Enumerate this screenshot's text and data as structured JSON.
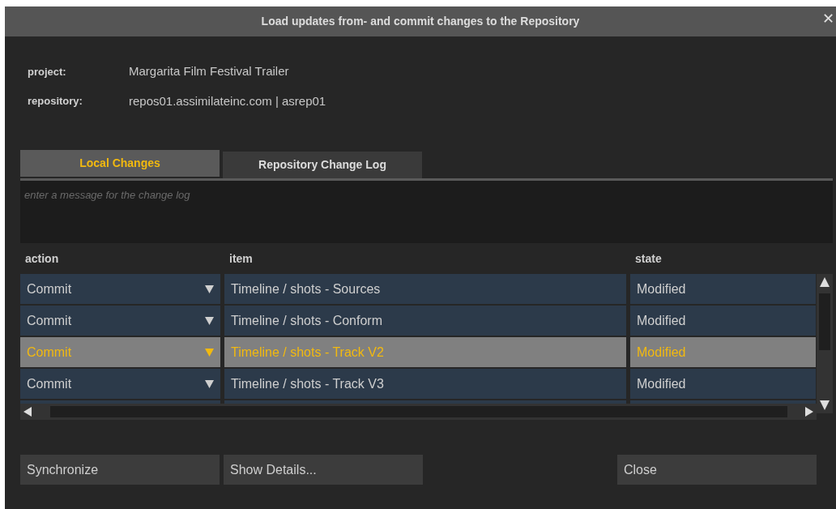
{
  "window": {
    "title": "Load updates from- and commit changes to the Repository",
    "close": "✕"
  },
  "info": [
    {
      "label": "project:",
      "value": "Margarita Film Festival Trailer"
    },
    {
      "label": "repository:",
      "value": "repos01.assimilateinc.com | asrep01"
    }
  ],
  "tabs": [
    {
      "label": "Local Changes",
      "selected": true
    },
    {
      "label": "Repository Change Log",
      "selected": false
    }
  ],
  "message": {
    "placeholder": "enter a message for the change log"
  },
  "table": {
    "columns": [
      "action",
      "item",
      "state"
    ],
    "rows": [
      {
        "action": "Commit",
        "item": "Timeline / shots - Sources",
        "state": "Modified",
        "selected": false
      },
      {
        "action": "Commit",
        "item": "Timeline / shots - Conform",
        "state": "Modified",
        "selected": false
      },
      {
        "action": "Commit",
        "item": "Timeline / shots - Track V2",
        "state": "Modified",
        "selected": true
      },
      {
        "action": "Commit",
        "item": "Timeline / shots - Track V3",
        "state": "Modified",
        "selected": false
      }
    ]
  },
  "buttons": [
    {
      "label": "Synchronize"
    },
    {
      "label": "Show Details..."
    },
    {
      "label": "Close"
    }
  ]
}
